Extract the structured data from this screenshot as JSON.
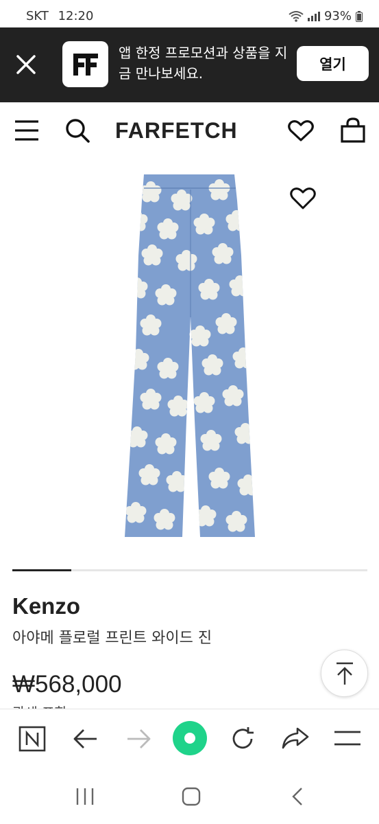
{
  "status_bar": {
    "carrier": "SKT",
    "time": "12:20",
    "battery": "93%"
  },
  "banner": {
    "message": "앱 한정 프로모션과 상품을 지금 만나보세요.",
    "open_label": "열기"
  },
  "header": {
    "brand": "FARFETCH"
  },
  "product": {
    "image_progress_fraction": 0.166,
    "designer": "Kenzo",
    "name": "아야메 플로럴 프린트 와이드 진",
    "price": "₩568,000",
    "subline": "관세 포함"
  },
  "toolbar": {
    "icons": [
      "n-icon",
      "back-arrow-icon",
      "forward-arrow-icon",
      "home-dot-icon",
      "refresh-icon",
      "share-icon",
      "menu-icon"
    ]
  },
  "colors": {
    "banner_bg": "#222222",
    "denim": "#7f9fcf",
    "flower": "#eeefe9",
    "accent_green": "#1fd38a"
  }
}
